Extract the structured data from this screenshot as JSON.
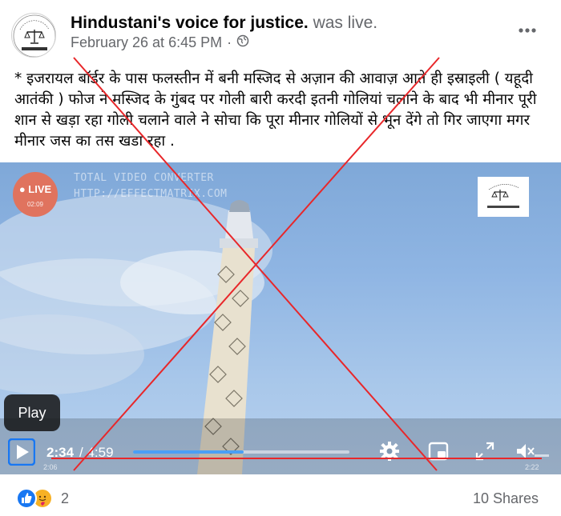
{
  "post": {
    "author": "Hindustani's voice for justice.",
    "author_suffix": "was live.",
    "timestamp": "February 26 at 6:45 PM",
    "privacy_separator": "·",
    "privacy_icon": "globe-icon",
    "more_icon": "more-options-icon",
    "text": "* इजरायल बॉर्डर के पास फलस्तीन में बनी मस्जिद से अज़ान की आवाज़ आते ही इस्राइली ( यहूदी आतंकी ) फोज ने मस्जिद के गुंबद पर गोली बारी करदी इतनी गोलियां चलाने के बाद भी मीनार पूरी शान से खड़ा रहा गोली चलाने वाले ने सोचा कि पूरा मीनार गोलियों से भून देंगे तो गिर जाएगा मगर मीनार जस का तस खडा रहा ."
  },
  "video": {
    "watermark_line1": "TOTAL VIDEO CONVERTER",
    "watermark_line2": "HTTP://EFFECTMATRIX.COM",
    "live_label": "LIVE",
    "live_time": "02:09",
    "tooltip": "Play",
    "time_current": "2:34",
    "time_total": "/ 4:59",
    "progress": 0.51,
    "small_time_left": "2:06",
    "small_time_right": "2:22",
    "icons": [
      "play-icon",
      "settings-gear-icon",
      "picture-in-picture-icon",
      "fullscreen-icon",
      "mute-icon"
    ]
  },
  "footer": {
    "reaction_count": "2",
    "shares": "10 Shares",
    "reaction_icons": [
      "like-icon",
      "care-icon"
    ]
  },
  "colors": {
    "overlay_x": "#e8272a",
    "accent_blue": "#1877f2",
    "secondary_text": "#65676b"
  }
}
